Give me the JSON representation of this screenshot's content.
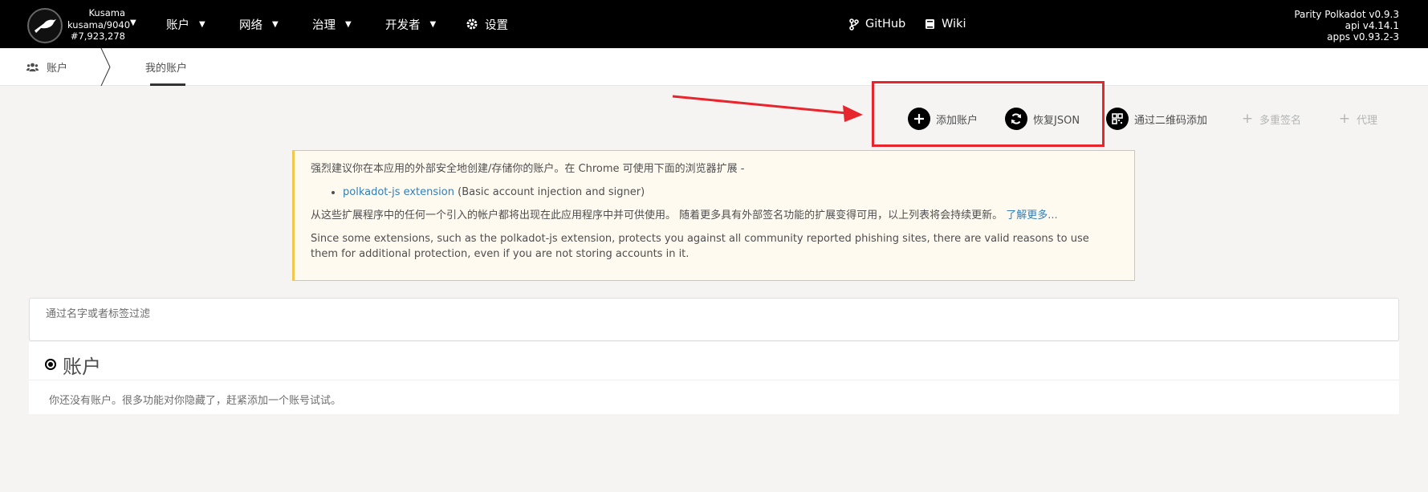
{
  "chain": {
    "name": "Kusama",
    "node": "kusama/9040",
    "block": "#7,923,278"
  },
  "nav": [
    {
      "label": "账户",
      "has_dropdown": true
    },
    {
      "label": "网络",
      "has_dropdown": true
    },
    {
      "label": "治理",
      "has_dropdown": true
    },
    {
      "label": "开发者",
      "has_dropdown": true
    },
    {
      "label": "设置",
      "icon": "gear-icon"
    }
  ],
  "links": {
    "github": "GitHub",
    "wiki": "Wiki"
  },
  "versions": {
    "node": "Parity Polkadot v0.9.3",
    "api": "api v4.14.1",
    "apps": "apps v0.93.2-3"
  },
  "tabs": {
    "root": "账户",
    "active": "我的账户"
  },
  "actions": {
    "add_account": "添加账户",
    "restore_json": "恢复JSON",
    "add_qr": "通过二维码添加",
    "multisig": "多重签名",
    "proxy": "代理"
  },
  "warning": {
    "line1": "强烈建议你在本应用的外部安全地创建/存储你的账户。在 Chrome 可使用下面的浏览器扩展 -",
    "ext_link": "polkadot-js extension",
    "ext_desc": " (Basic account injection and signer)",
    "line2": "从这些扩展程序中的任何一个引入的帐户都将出现在此应用程序中并可供使用。 随着更多具有外部签名功能的扩展变得可用，以上列表将会持续更新。",
    "learn_more": "了解更多...",
    "line3": "Since some extensions, such as the polkadot-js extension, protects you against all community reported phishing sites, there are valid reasons to use them for additional protection, even if you are not storing accounts in it."
  },
  "filter": {
    "placeholder": "通过名字或者标签过滤",
    "value": ""
  },
  "accounts": {
    "title": "账户",
    "empty_message": "你还没有账户。很多功能对你隐藏了，赶紧添加一个账号试试。"
  },
  "colors": {
    "accent_red": "#e8252c",
    "warning_border": "#f3c74b",
    "link": "#2f7fbd"
  }
}
